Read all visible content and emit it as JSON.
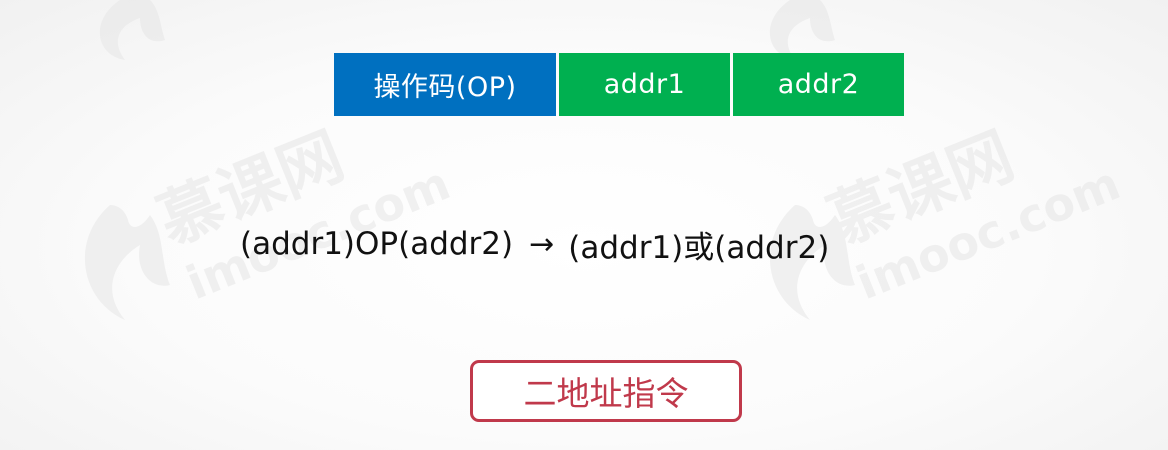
{
  "instruction_format": {
    "fields": [
      {
        "label": "操作码(OP)",
        "color": "#0070c0"
      },
      {
        "label": "addr1",
        "color": "#00b050"
      },
      {
        "label": "addr2",
        "color": "#00b050"
      }
    ]
  },
  "formula": {
    "left": "(addr1)OP(addr2)",
    "arrow": "→",
    "right": "(addr1)或(addr2)"
  },
  "caption": {
    "text": "二地址指令",
    "color": "#c0394b"
  },
  "watermark": {
    "brand": "慕课网",
    "domain": "imooc.com"
  }
}
